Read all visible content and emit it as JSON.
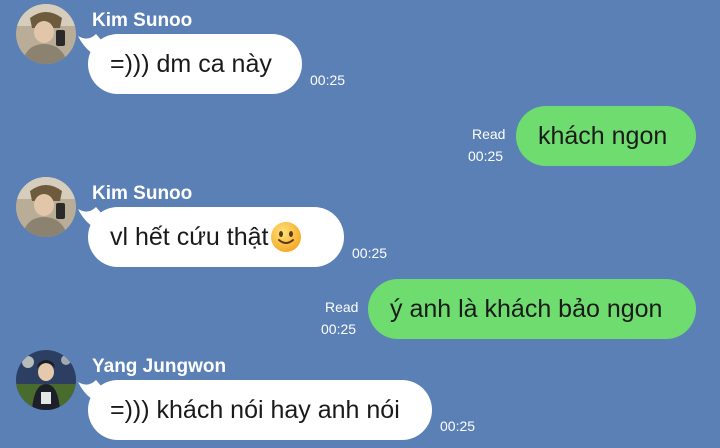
{
  "colors": {
    "background": "#5a80b6",
    "incoming_bubble": "#ffffff",
    "outgoing_bubble": "#6fdc6f",
    "meta_text": "#ffffff"
  },
  "messages": [
    {
      "direction": "incoming",
      "sender": "Kim Sunoo",
      "avatar": "avatar-photo-icon",
      "text": "=))) dm ca này",
      "time": "00:25"
    },
    {
      "direction": "outgoing",
      "status": "Read",
      "text": "khách ngon",
      "time": "00:25"
    },
    {
      "direction": "incoming",
      "sender": "Kim Sunoo",
      "avatar": "avatar-photo-icon",
      "text": "vl hết cứu thật",
      "emoji": "smiling-face-icon",
      "time": "00:25"
    },
    {
      "direction": "outgoing",
      "status": "Read",
      "text": "ý anh là khách bảo ngon",
      "time": "00:25"
    },
    {
      "direction": "incoming",
      "sender": "Yang Jungwon",
      "avatar": "avatar-photo-icon",
      "text": "=))) khách nói hay anh nói",
      "time": "00:25"
    }
  ]
}
